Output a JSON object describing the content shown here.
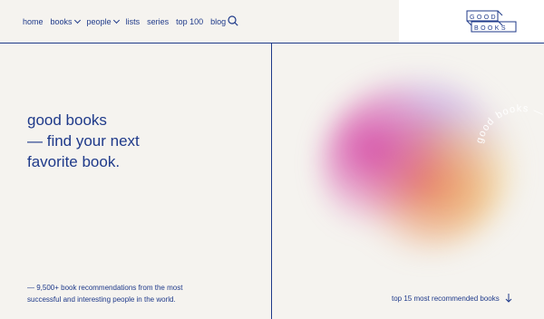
{
  "nav": {
    "home": "home",
    "books": "books",
    "people": "people",
    "lists": "lists",
    "series": "series",
    "top100": "top 100",
    "blog": "blog"
  },
  "logo": {
    "line1": "GOOD",
    "line2": "BOOKS"
  },
  "hero": {
    "line1": "good books",
    "line2": "— find your next",
    "line3": "favorite book."
  },
  "description": "— 9,500+ book recommendations from the most successful and interesting people in the world.",
  "rotating_text": "good books — start to find",
  "top15_link": "top 15 most recommended books",
  "colors": {
    "primary": "#1f3a8a",
    "background": "#f5f3ef"
  }
}
